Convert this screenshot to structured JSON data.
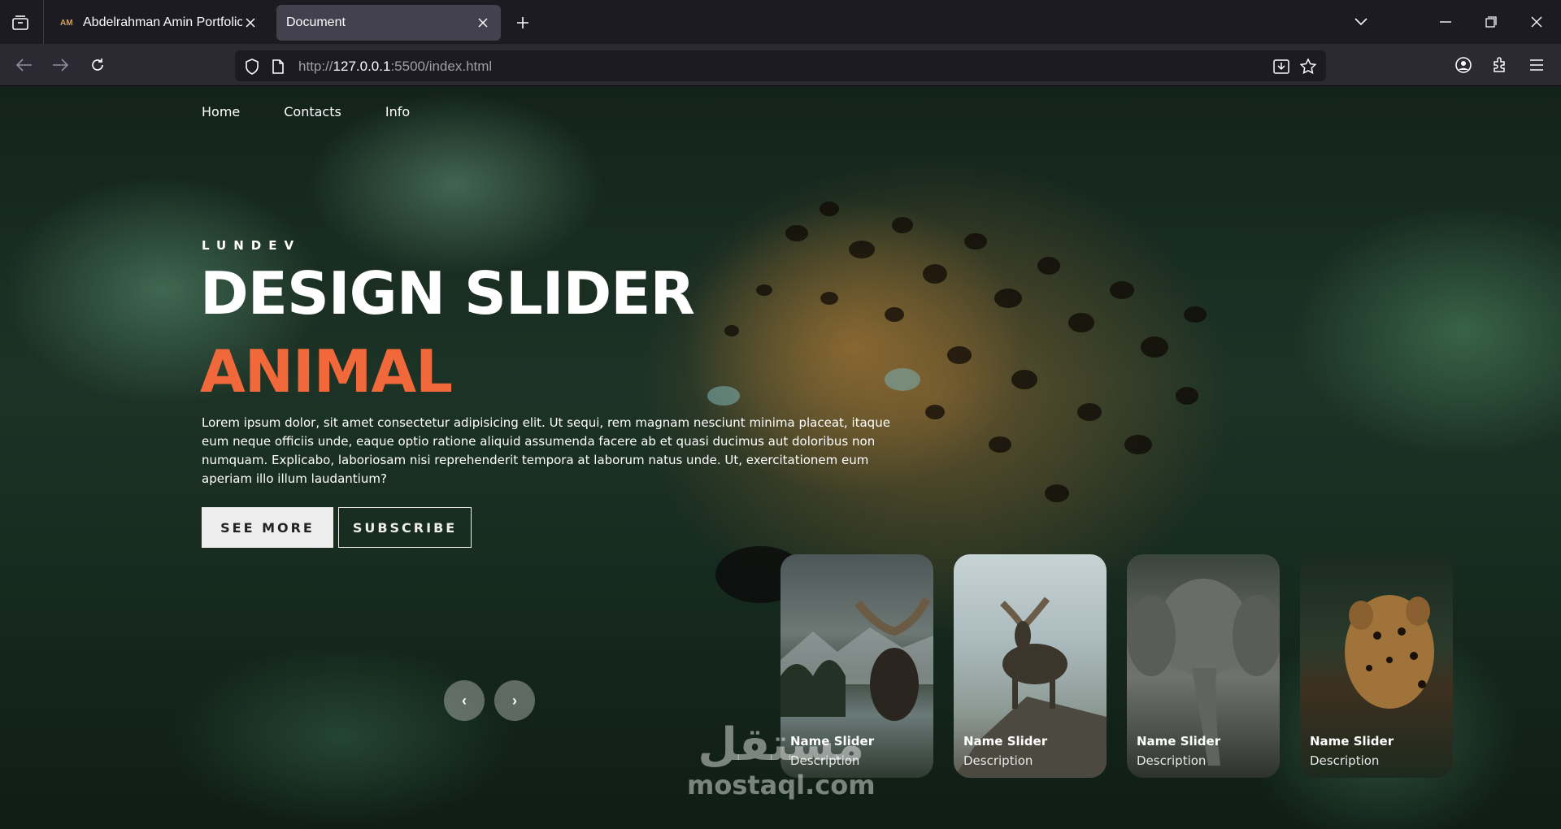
{
  "browser": {
    "tabs": [
      {
        "label": "Abdelrahman Amin Portfolio",
        "favicon": "AM",
        "active": false
      },
      {
        "label": "Document",
        "active": true
      }
    ],
    "url": {
      "prefix": "http://",
      "host": "127.0.0.1",
      "suffix": ":5500/index.html"
    }
  },
  "page": {
    "menu": [
      "Home",
      "Contacts",
      "Info"
    ],
    "author": "LUNDEV",
    "title": "DESIGN SLIDER",
    "topic": "ANIMAL",
    "description": "Lorem ipsum dolor, sit amet consectetur adipisicing elit. Ut sequi, rem magnam nesciunt minima placeat, itaque eum neque officiis unde, eaque optio ratione aliquid assumenda facere ab et quasi ducimus aut doloribus non numquam. Explicabo, laboriosam nisi reprehenderit tempora at laborum natus unde. Ut, exercitationem eum aperiam illo illum laudantium?",
    "buttons": {
      "see_more": "SEE MORE",
      "subscribe": "SUBSCRIBE"
    },
    "arrows": {
      "prev": "‹",
      "next": "›"
    },
    "thumbnails": [
      {
        "name": "Name Slider",
        "description": "Description",
        "image": "moose-lake"
      },
      {
        "name": "Name Slider",
        "description": "Description",
        "image": "moose-rock"
      },
      {
        "name": "Name Slider",
        "description": "Description",
        "image": "elephant"
      },
      {
        "name": "Name Slider",
        "description": "Description",
        "image": "jaguar"
      }
    ],
    "watermark": {
      "arabic": "مستقل",
      "latin": "mostaql.com"
    },
    "accent_color": "#f1683a"
  }
}
